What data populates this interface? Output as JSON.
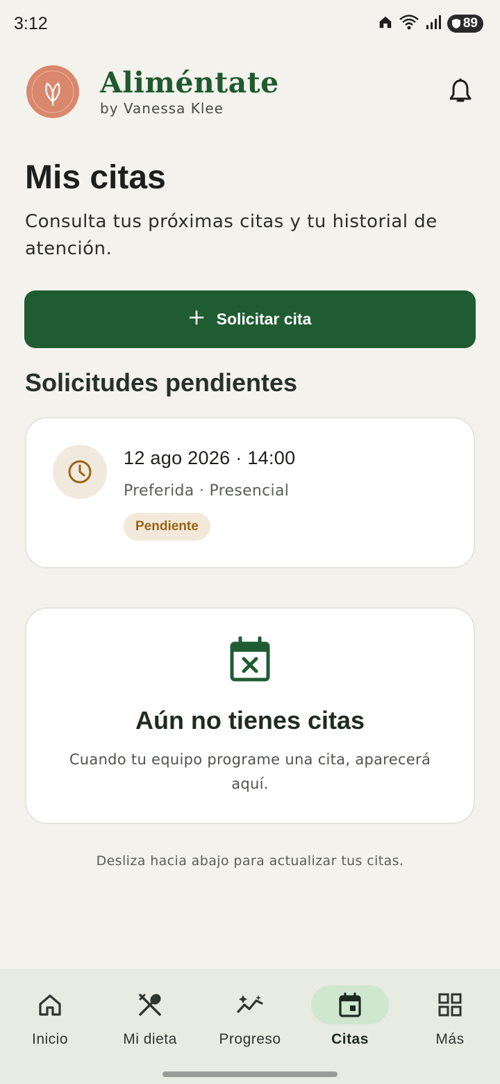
{
  "status_bar": {
    "time": "3:12",
    "battery": "89",
    "icons": [
      "home-icon",
      "wifi-icon",
      "signal-icon",
      "battery-icon"
    ]
  },
  "header": {
    "logo_text": "ALIMÉNTATE",
    "logo_subtext": "BY VANESSA KLEE",
    "brand_name": "Aliméntate",
    "brand_sub": "by Vanessa Klee",
    "notification_icon": "bell-icon"
  },
  "page": {
    "title": "Mis citas",
    "description": "Consulta tus próximas citas y tu historial de atención."
  },
  "request_button": {
    "label": "Solicitar cita",
    "icon": "plus-icon"
  },
  "pending": {
    "section_title": "Solicitudes pendientes",
    "items": [
      {
        "date": "12 ago 2026 · 14:00",
        "meta": "Preferida · Presencial",
        "status": "Pendiente",
        "icon": "clock-icon"
      }
    ]
  },
  "empty_state": {
    "icon": "calendar-x-icon",
    "title": "Aún no tienes citas",
    "description": "Cuando tu equipo programe una cita, aparecerá aquí."
  },
  "hint": "Desliza hacia abajo para actualizar tus citas.",
  "bottom_nav": {
    "items": [
      {
        "label": "Inicio",
        "icon": "home-icon",
        "active": false
      },
      {
        "label": "Mi dieta",
        "icon": "utensils-icon",
        "active": false
      },
      {
        "label": "Progreso",
        "icon": "trend-icon",
        "active": false
      },
      {
        "label": "Citas",
        "icon": "calendar-icon",
        "active": true
      },
      {
        "label": "Más",
        "icon": "grid-icon",
        "active": false
      }
    ]
  },
  "colors": {
    "primary": "#1f5c31",
    "brand_text": "#1f5a2e",
    "background": "#f3f2ec",
    "pending_badge_bg": "#f2e9db",
    "pending_badge_text": "#9a6414",
    "logo_bg": "#d9876d",
    "nav_active_bg": "#cfe6cf"
  }
}
